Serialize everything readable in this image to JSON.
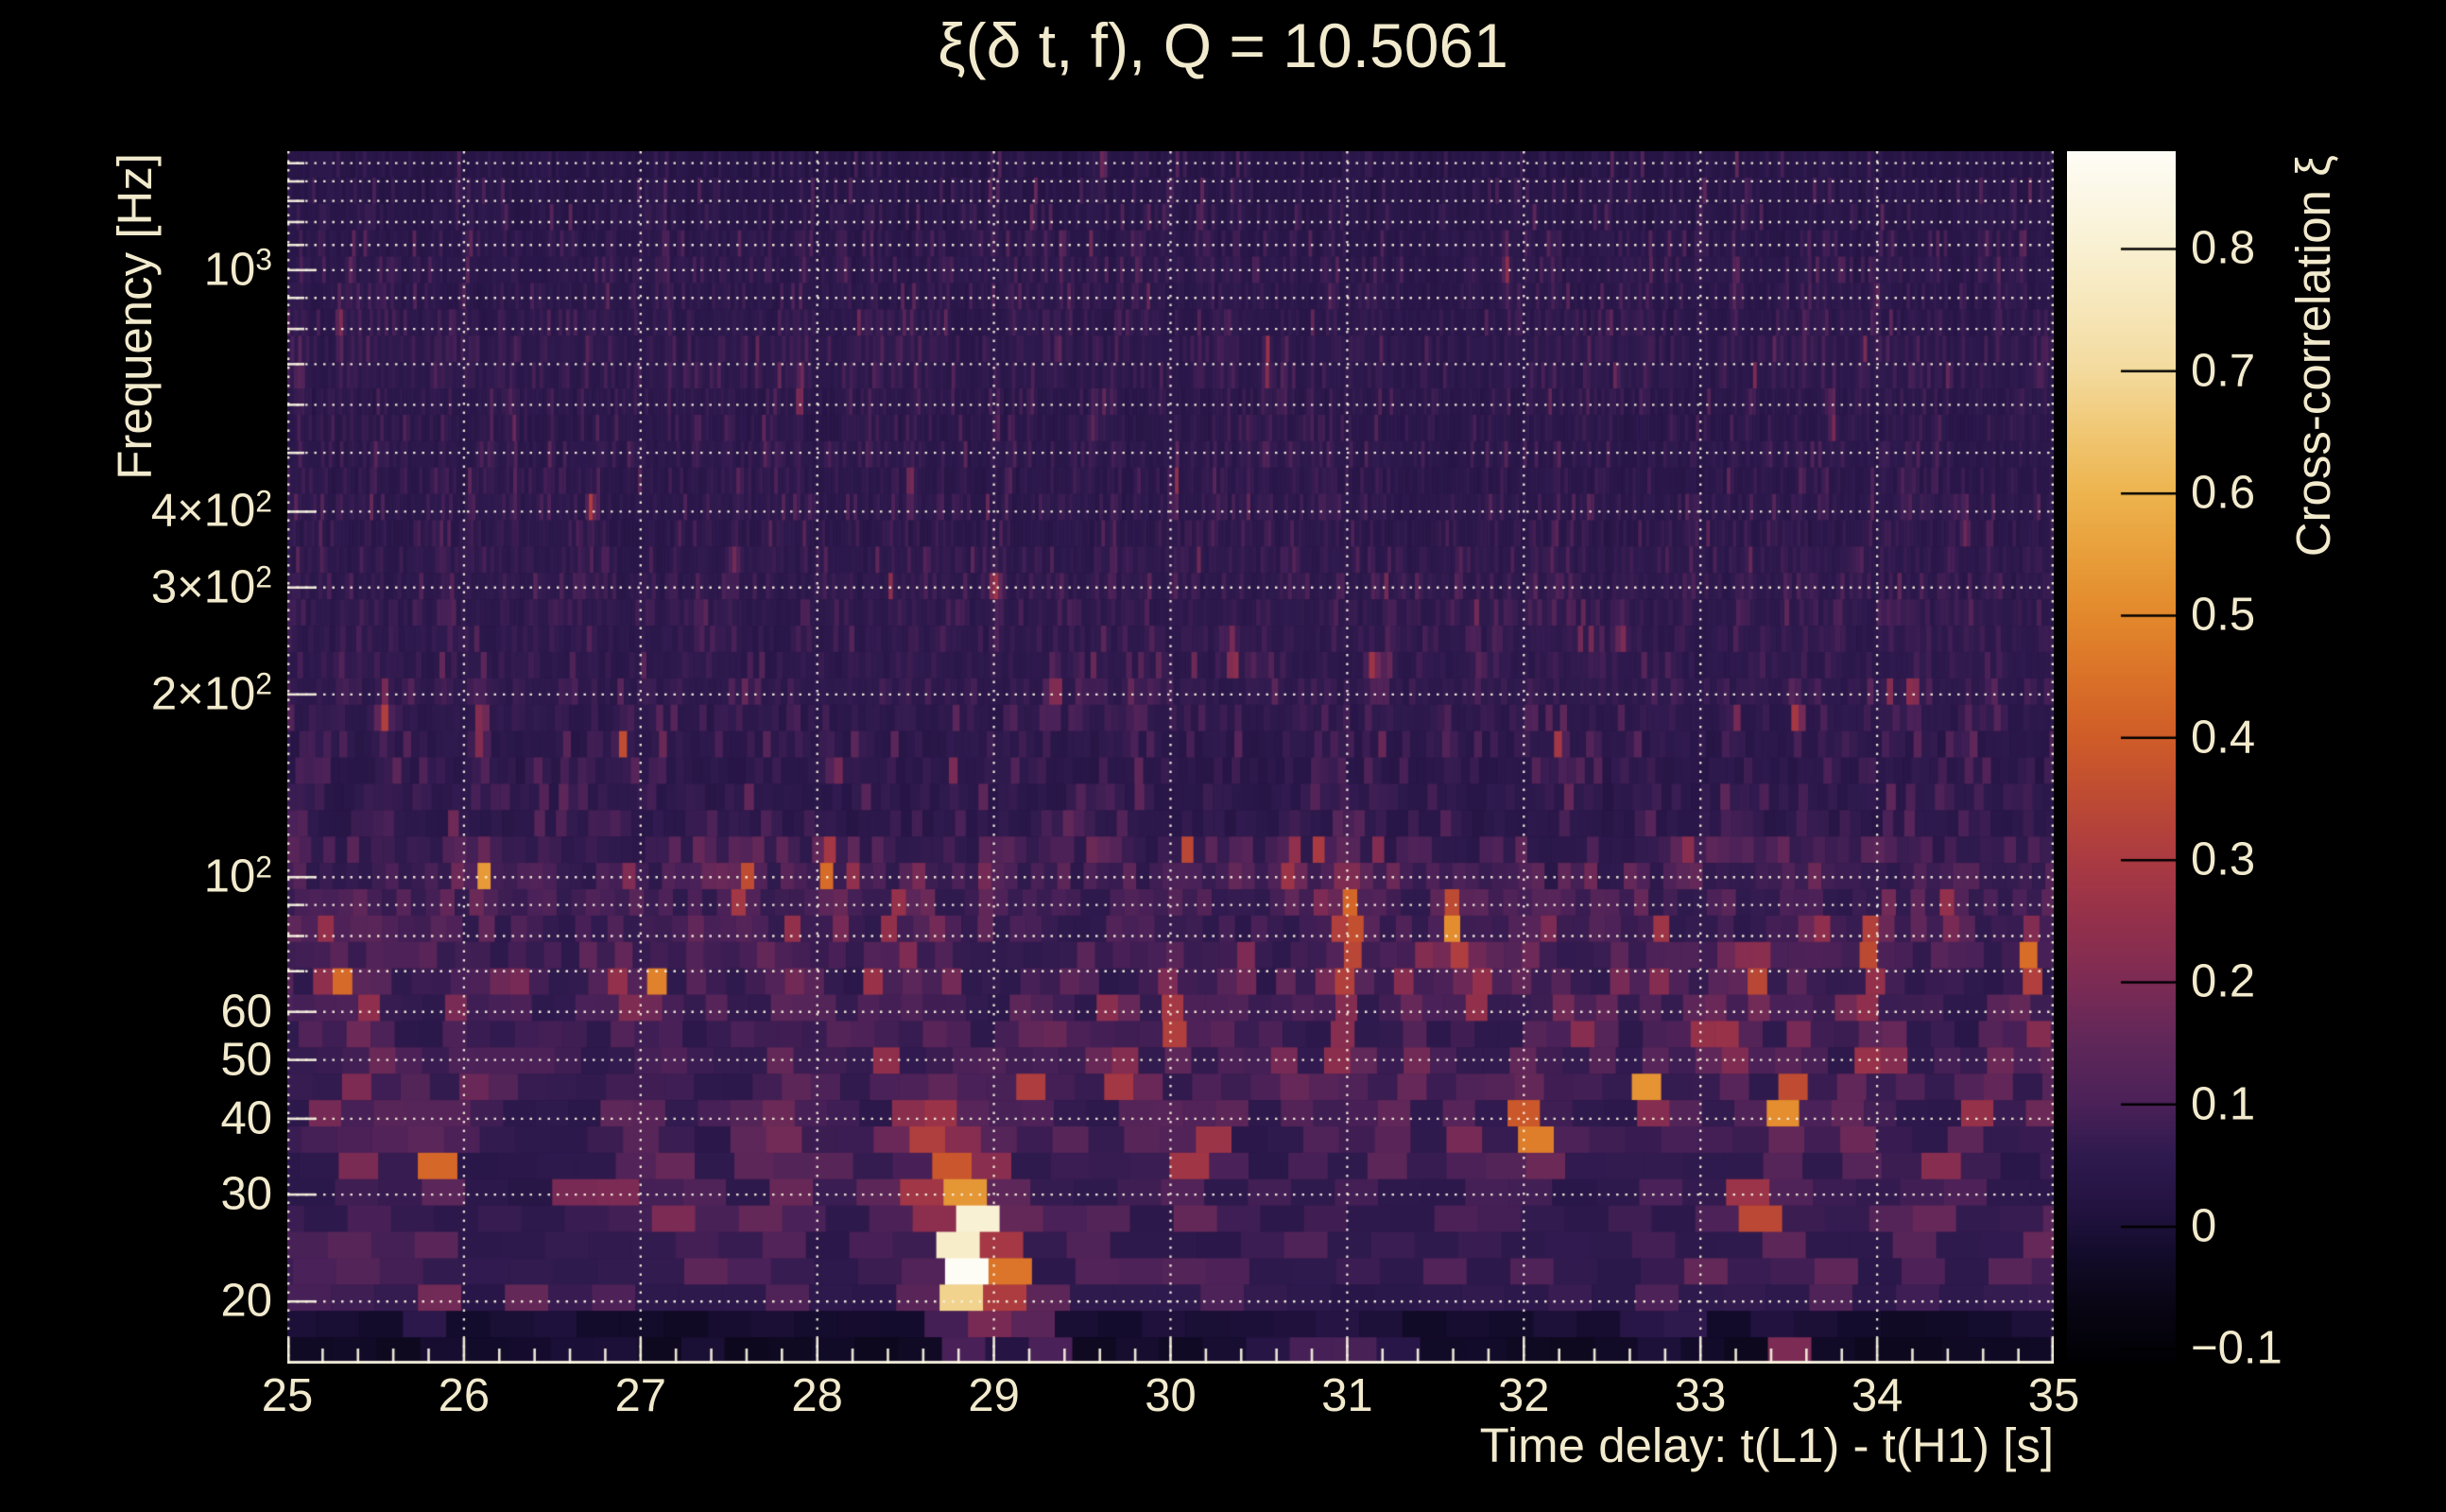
{
  "figure": {
    "title": "ξ(δ t, f), Q = 10.5061",
    "background_color": "#000000",
    "text_color": "#f2eacd",
    "grid_color": "#f6f0dc"
  },
  "axes": {
    "xlabel": "Time delay: t(L1) - t(H1) [s]",
    "ylabel": "Frequency [Hz]",
    "x_range": [
      25,
      35
    ],
    "x_ticks": [
      25,
      26,
      27,
      28,
      29,
      30,
      31,
      32,
      33,
      34,
      35
    ],
    "x_minor_step": 0.2,
    "y_scale": "log",
    "y_range_hz": [
      15.8,
      1570
    ],
    "y_major_ticks": [
      {
        "text": "10",
        "sup": "3",
        "hz": 1000
      },
      {
        "text": "4×10",
        "sup": "2",
        "hz": 400
      },
      {
        "text": "3×10",
        "sup": "2",
        "hz": 300
      },
      {
        "text": "2×10",
        "sup": "2",
        "hz": 200
      },
      {
        "text": "10",
        "sup": "2",
        "hz": 100
      },
      {
        "text": "60",
        "hz": 60
      },
      {
        "text": "50",
        "hz": 50
      },
      {
        "text": "40",
        "hz": 40
      },
      {
        "text": "30",
        "hz": 30
      },
      {
        "text": "20",
        "hz": 20
      }
    ],
    "y_minor_ticks_hz": [
      70,
      80,
      90,
      500,
      600,
      700,
      800,
      900,
      1100,
      1200,
      1300,
      1400,
      1500
    ]
  },
  "colorbar": {
    "label": "Cross-correlation ξ",
    "vmin": -0.112,
    "vmax": 0.88,
    "ticks": [
      {
        "text": "0.8",
        "v": 0.8
      },
      {
        "text": "0.7",
        "v": 0.7
      },
      {
        "text": "0.6",
        "v": 0.6
      },
      {
        "text": "0.5",
        "v": 0.5
      },
      {
        "text": "0.4",
        "v": 0.4
      },
      {
        "text": "0.3",
        "v": 0.3
      },
      {
        "text": "0.2",
        "v": 0.2
      },
      {
        "text": "0.1",
        "v": 0.1
      },
      {
        "text": "0",
        "v": 0.0
      },
      {
        "text": "−0.1",
        "v": -0.1
      }
    ],
    "stops": [
      [
        -0.112,
        "#000003"
      ],
      [
        -0.06,
        "#0a0616"
      ],
      [
        -0.02,
        "#140c2c"
      ],
      [
        0.0,
        "#1c1038"
      ],
      [
        0.03,
        "#271546"
      ],
      [
        0.06,
        "#2f1a4e"
      ],
      [
        0.1,
        "#4a2158"
      ],
      [
        0.15,
        "#5f2759"
      ],
      [
        0.2,
        "#7c2b54"
      ],
      [
        0.25,
        "#93304b"
      ],
      [
        0.3,
        "#aa3a42"
      ],
      [
        0.35,
        "#bd4a33"
      ],
      [
        0.4,
        "#cf5c28"
      ],
      [
        0.45,
        "#da7128"
      ],
      [
        0.5,
        "#e2882c"
      ],
      [
        0.55,
        "#e89e3a"
      ],
      [
        0.6,
        "#edb44e"
      ],
      [
        0.65,
        "#f0c773"
      ],
      [
        0.7,
        "#f3da9d"
      ],
      [
        0.75,
        "#f6e6b8"
      ],
      [
        0.8,
        "#f9f0d1"
      ],
      [
        0.88,
        "#fefdf6"
      ]
    ]
  },
  "chart_data": {
    "type": "heatmap",
    "title": "ξ(δ t, f), Q = 10.5061",
    "q_value": 10.5061,
    "xlabel": "Time delay: t(L1) - t(H1) [s]",
    "ylabel": "Frequency [Hz]",
    "colorbar_label": "Cross-correlation ξ",
    "x_range": [
      25,
      35
    ],
    "y_range_hz": [
      15.8,
      1570
    ],
    "xi_range": [
      -0.112,
      0.88
    ],
    "grid": "dotted, at every x integer and every log-decade subdivision in y",
    "features_format": "[time_delay_s, f_low_hz, f_high_hz, peak_xi, sigma_t_s]",
    "features": [
      [
        28.87,
        16,
        42,
        0.5,
        0.13
      ],
      [
        28.88,
        17,
        30,
        0.82,
        0.06
      ],
      [
        29.15,
        16,
        27,
        0.46,
        0.05
      ],
      [
        28.62,
        28,
        40,
        0.4,
        0.035
      ],
      [
        28.7,
        35,
        42,
        0.4,
        0.03
      ],
      [
        29.32,
        16,
        20,
        0.3,
        0.05
      ],
      [
        33.4,
        24,
        34,
        0.6,
        0.05
      ],
      [
        33.47,
        37,
        48,
        0.46,
        0.035
      ],
      [
        33.52,
        16,
        19,
        0.44,
        0.06
      ],
      [
        33.35,
        58,
        80,
        0.33,
        0.03
      ],
      [
        33.1,
        46,
        62,
        0.36,
        0.03
      ],
      [
        32.08,
        33,
        47,
        0.52,
        0.045
      ],
      [
        31.97,
        30,
        40,
        0.36,
        0.035
      ],
      [
        32.37,
        46,
        60,
        0.4,
        0.03
      ],
      [
        32.7,
        41,
        51,
        0.38,
        0.03
      ],
      [
        31.0,
        58,
        118,
        0.46,
        0.035
      ],
      [
        30.93,
        48,
        63,
        0.4,
        0.03
      ],
      [
        30.05,
        50,
        67,
        0.42,
        0.03
      ],
      [
        30.15,
        26,
        40,
        0.3,
        0.05
      ],
      [
        30.7,
        88,
        120,
        0.32,
        0.025
      ],
      [
        30.4,
        90,
        118,
        0.28,
        0.025
      ],
      [
        30.1,
        98,
        120,
        0.3,
        0.025
      ],
      [
        31.6,
        70,
        100,
        0.4,
        0.03
      ],
      [
        31.73,
        58,
        73,
        0.36,
        0.03
      ],
      [
        31.35,
        45,
        55,
        0.3,
        0.03
      ],
      [
        30.9,
        15.8,
        18,
        0.15,
        0.3
      ],
      [
        26.1,
        88,
        114,
        0.46,
        0.03
      ],
      [
        27.58,
        84,
        112,
        0.44,
        0.03
      ],
      [
        28.05,
        90,
        120,
        0.42,
        0.03
      ],
      [
        25.48,
        47,
        63,
        0.36,
        0.03
      ],
      [
        25.83,
        29,
        38,
        0.33,
        0.04
      ],
      [
        26.9,
        54,
        76,
        0.32,
        0.03
      ],
      [
        26.57,
        25,
        33,
        0.28,
        0.05
      ],
      [
        27.35,
        95,
        115,
        0.3,
        0.025
      ],
      [
        28.35,
        45,
        55,
        0.3,
        0.03
      ],
      [
        27.8,
        30,
        38,
        0.28,
        0.04
      ],
      [
        28.3,
        25,
        32,
        0.26,
        0.04
      ],
      [
        25.3,
        60,
        75,
        0.28,
        0.03
      ],
      [
        27.1,
        58,
        74,
        0.3,
        0.03
      ],
      [
        29.55,
        47,
        58,
        0.4,
        0.03
      ],
      [
        29.72,
        43,
        52,
        0.34,
        0.03
      ],
      [
        33.9,
        44,
        56,
        0.42,
        0.03
      ],
      [
        34.05,
        49,
        59,
        0.38,
        0.03
      ],
      [
        34.7,
        49,
        61,
        0.46,
        0.03
      ],
      [
        34.85,
        58,
        88,
        0.38,
        0.03
      ],
      [
        33.95,
        68,
        88,
        0.3,
        0.025
      ],
      [
        34.35,
        26,
        36,
        0.3,
        0.05
      ],
      [
        34.95,
        46,
        60,
        0.35,
        0.03
      ],
      [
        34.4,
        70,
        85,
        0.28,
        0.025
      ],
      [
        32.95,
        95,
        115,
        0.25,
        0.025
      ],
      [
        25.55,
        165,
        210,
        0.28,
        0.02
      ],
      [
        26.1,
        150,
        200,
        0.26,
        0.02
      ],
      [
        26.9,
        150,
        180,
        0.24,
        0.02
      ],
      [
        28.1,
        140,
        165,
        0.24,
        0.02
      ],
      [
        30.35,
        210,
        255,
        0.28,
        0.02
      ],
      [
        32.2,
        150,
        175,
        0.26,
        0.02
      ],
      [
        33.55,
        170,
        200,
        0.28,
        0.02
      ],
      [
        34.2,
        185,
        215,
        0.26,
        0.02
      ],
      [
        29.0,
        280,
        330,
        0.22,
        0.018
      ],
      [
        29.35,
        180,
        220,
        0.22,
        0.02
      ],
      [
        31.15,
        200,
        240,
        0.22,
        0.02
      ],
      [
        32.55,
        230,
        280,
        0.2,
        0.018
      ],
      [
        26.72,
        380,
        440,
        0.22,
        0.015
      ],
      [
        28.53,
        400,
        470,
        0.18,
        0.015
      ],
      [
        34.5,
        350,
        420,
        0.2,
        0.015
      ],
      [
        30.55,
        600,
        800,
        0.18,
        0.012
      ],
      [
        33.75,
        500,
        650,
        0.18,
        0.012
      ],
      [
        25.3,
        700,
        950,
        0.16,
        0.012
      ],
      [
        31.9,
        900,
        1200,
        0.16,
        0.012
      ],
      [
        27.9,
        550,
        700,
        0.16,
        0.012
      ]
    ],
    "noise": {
      "seed": 7,
      "rows": 46,
      "tile_width_px": "clamp(1400/f_center_hz, 4, 46)",
      "base_xi_by_band": {
        "below_18.5": -0.055,
        "18.5_40": 0.034,
        "40_120": 0.042,
        "120_300": 0.03,
        "300_1100": 0.027,
        "above_1100": 0.022
      },
      "spike_scale_by_band": {
        "above_120": 0.034,
        "35_120": 0.056,
        "18.5_35": 0.046,
        "below_18.5": 0.02
      }
    }
  }
}
